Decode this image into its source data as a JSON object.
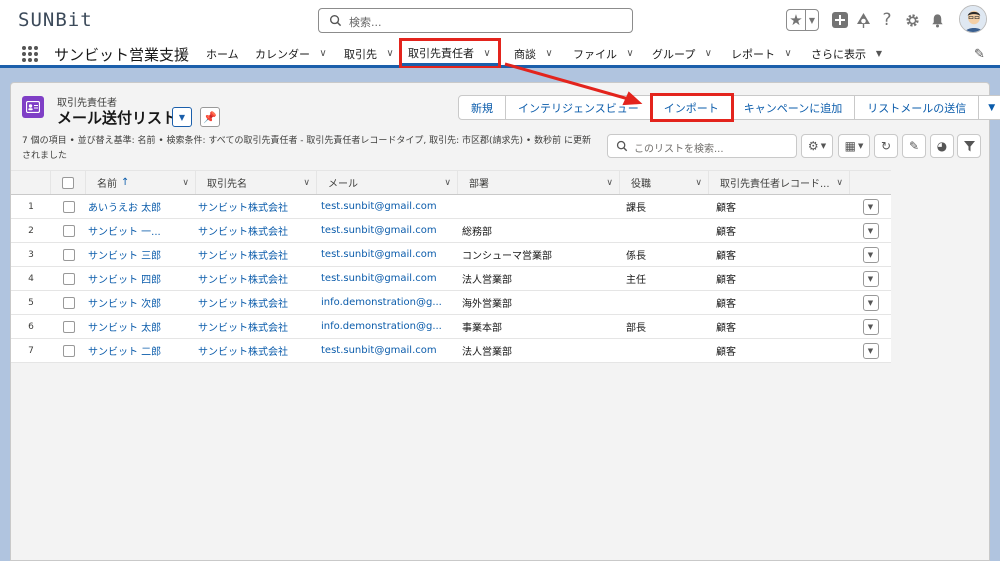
{
  "header": {
    "logo": "SUNBit",
    "search_placeholder": "検索..."
  },
  "app_nav": {
    "app_name": "サンビット営業支援",
    "items": [
      {
        "label": "ホーム"
      },
      {
        "label": "カレンダー"
      },
      {
        "label": "取引先"
      },
      {
        "label": "取引先責任者"
      },
      {
        "label": "商談"
      },
      {
        "label": "ファイル"
      },
      {
        "label": "グループ"
      },
      {
        "label": "レポート"
      },
      {
        "label": "さらに表示"
      }
    ]
  },
  "list_view": {
    "object_label": "取引先責任者",
    "title": "メール送付リスト",
    "info": "7 個の項目 • 並び替え基準: 名前 • 検索条件: すべての取引先責任者 - 取引先責任者レコードタイプ, 取引先: 市区郡(請求先) • 数秒前 に更新されました",
    "actions": [
      "新規",
      "インテリジェンスビュー",
      "インポート",
      "キャンペーンに追加",
      "リストメールの送信"
    ],
    "search_placeholder": "このリストを検索...",
    "columns": [
      "名前",
      "取引先名",
      "メール",
      "部署",
      "役職",
      "取引先責任者レコード..."
    ],
    "rows": [
      {
        "num": "1",
        "name": "あいうえお 太郎",
        "account": "サンビット株式会社",
        "email": "test.sunbit@gmail.com",
        "dept": "",
        "title": "課長",
        "type": "顧客"
      },
      {
        "num": "2",
        "name": "サンビット 一...",
        "account": "サンビット株式会社",
        "email": "test.sunbit@gmail.com",
        "dept": "総務部",
        "title": "",
        "type": "顧客"
      },
      {
        "num": "3",
        "name": "サンビット 三郎",
        "account": "サンビット株式会社",
        "email": "test.sunbit@gmail.com",
        "dept": "コンシューマ営業部",
        "title": "係長",
        "type": "顧客"
      },
      {
        "num": "4",
        "name": "サンビット 四郎",
        "account": "サンビット株式会社",
        "email": "test.sunbit@gmail.com",
        "dept": "法人営業部",
        "title": "主任",
        "type": "顧客"
      },
      {
        "num": "5",
        "name": "サンビット 次郎",
        "account": "サンビット株式会社",
        "email": "info.demonstration@g...",
        "dept": "海外営業部",
        "title": "",
        "type": "顧客"
      },
      {
        "num": "6",
        "name": "サンビット 太郎",
        "account": "サンビット株式会社",
        "email": "info.demonstration@g...",
        "dept": "事業本部",
        "title": "部長",
        "type": "顧客"
      },
      {
        "num": "7",
        "name": "サンビット 二郎",
        "account": "サンビット株式会社",
        "email": "test.sunbit@gmail.com",
        "dept": "法人営業部",
        "title": "",
        "type": "顧客"
      }
    ]
  },
  "colors": {
    "brand_blue": "#0b5cab",
    "annotation_red": "#e3241d",
    "object_icon": "#7f3fc6"
  }
}
